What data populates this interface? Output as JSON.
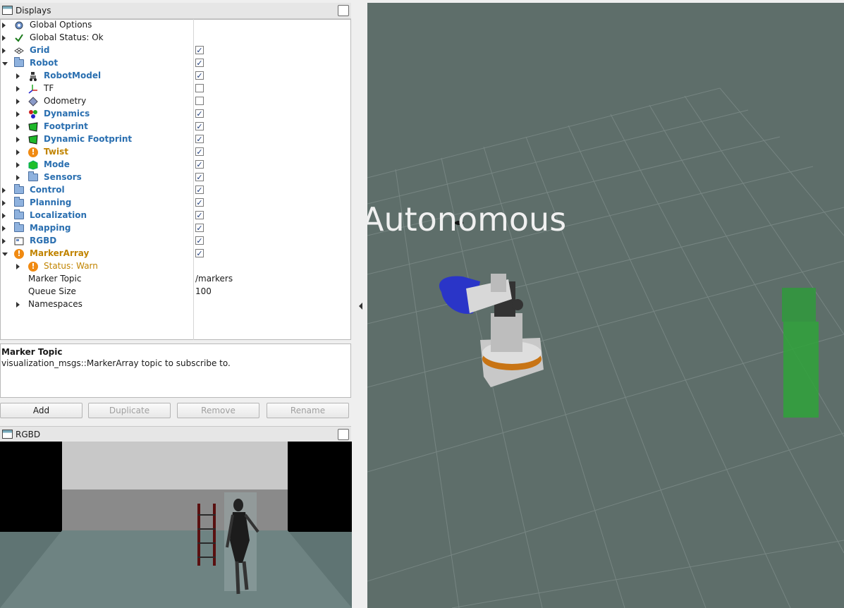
{
  "displays_panel": {
    "title": "Displays",
    "tree": [
      {
        "label": "Global Options",
        "icon": "gear-icon",
        "style": "plain"
      },
      {
        "label": "Global Status: Ok",
        "icon": "checkmark-icon",
        "style": "plain"
      },
      {
        "label": "Grid",
        "icon": "grid-icon",
        "style": "blue",
        "checked": true
      },
      {
        "label": "Robot",
        "icon": "folder-icon",
        "style": "blue",
        "checked": true,
        "expanded": true
      },
      {
        "label": "RobotModel",
        "icon": "robot-model-icon",
        "style": "blue",
        "checked": true
      },
      {
        "label": "TF",
        "icon": "axes-icon",
        "style": "plain",
        "checked": false
      },
      {
        "label": "Odometry",
        "icon": "diamond-icon",
        "style": "plain",
        "checked": false
      },
      {
        "label": "Dynamics",
        "icon": "colored-dots-icon",
        "style": "blue",
        "checked": true
      },
      {
        "label": "Footprint",
        "icon": "footprint-icon",
        "style": "blue",
        "checked": true
      },
      {
        "label": "Dynamic Footprint",
        "icon": "footprint-icon",
        "style": "blue",
        "checked": true
      },
      {
        "label": "Twist",
        "icon": "warning-icon",
        "style": "warn",
        "checked": true
      },
      {
        "label": "Mode",
        "icon": "green-cube-icon",
        "style": "blue",
        "checked": true
      },
      {
        "label": "Sensors",
        "icon": "folder-icon",
        "style": "blue",
        "checked": true
      },
      {
        "label": "Control",
        "icon": "folder-icon",
        "style": "blue",
        "checked": true
      },
      {
        "label": "Planning",
        "icon": "folder-icon",
        "style": "blue",
        "checked": true
      },
      {
        "label": "Localization",
        "icon": "folder-icon",
        "style": "blue",
        "checked": true
      },
      {
        "label": "Mapping",
        "icon": "folder-icon",
        "style": "blue",
        "checked": true
      },
      {
        "label": "RGBD",
        "icon": "image-icon",
        "style": "blue",
        "checked": true
      },
      {
        "label": "MarkerArray",
        "icon": "warning-icon",
        "style": "warn",
        "checked": true,
        "expanded": true
      },
      {
        "label": "Status: Warn",
        "icon": "warning-icon",
        "style": "warnplain"
      },
      {
        "label": "Marker Topic",
        "value": "/markers",
        "style": "plain"
      },
      {
        "label": "Queue Size",
        "value": "100",
        "style": "plain"
      },
      {
        "label": "Namespaces",
        "style": "plain"
      }
    ]
  },
  "help": {
    "title": "Marker Topic",
    "description": "visualization_msgs::MarkerArray topic to subscribe to."
  },
  "buttons": {
    "add": "Add",
    "duplicate": "Duplicate",
    "remove": "Remove",
    "rename": "Rename"
  },
  "rgbd_panel": {
    "title": "RGBD"
  },
  "viewport": {
    "overlay_text": "Autonomous",
    "background_color": "#5e6e6a"
  }
}
